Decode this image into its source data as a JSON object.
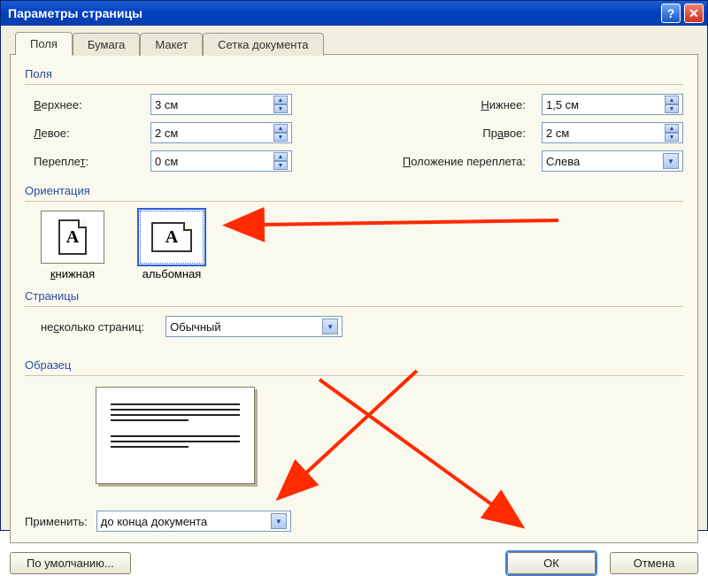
{
  "window": {
    "title": "Параметры страницы"
  },
  "tabs": {
    "fields": "Поля",
    "paper": "Бумага",
    "layout": "Макет",
    "grid": "Сетка документа"
  },
  "groups": {
    "fields": "Поля",
    "orientation": "Ориентация",
    "pages": "Страницы",
    "preview": "Образец"
  },
  "labels": {
    "top": "Верхнее:",
    "bottom": "Нижнее:",
    "left": "Левое:",
    "right": "Правое:",
    "gutter": "Переплет:",
    "gutter_pos": "Положение переплета:",
    "portrait": "книжная",
    "landscape": "альбомная",
    "multipage": "несколько страниц:",
    "apply": "Применить:"
  },
  "values": {
    "top": "3 см",
    "bottom": "1,5 см",
    "left": "2 см",
    "right": "2 см",
    "gutter": "0 см",
    "gutter_pos": "Слева",
    "multipage": "Обычный",
    "apply": "до конца документа"
  },
  "buttons": {
    "defaults": "По умолчанию...",
    "ok": "ОК",
    "cancel": "Отмена"
  }
}
